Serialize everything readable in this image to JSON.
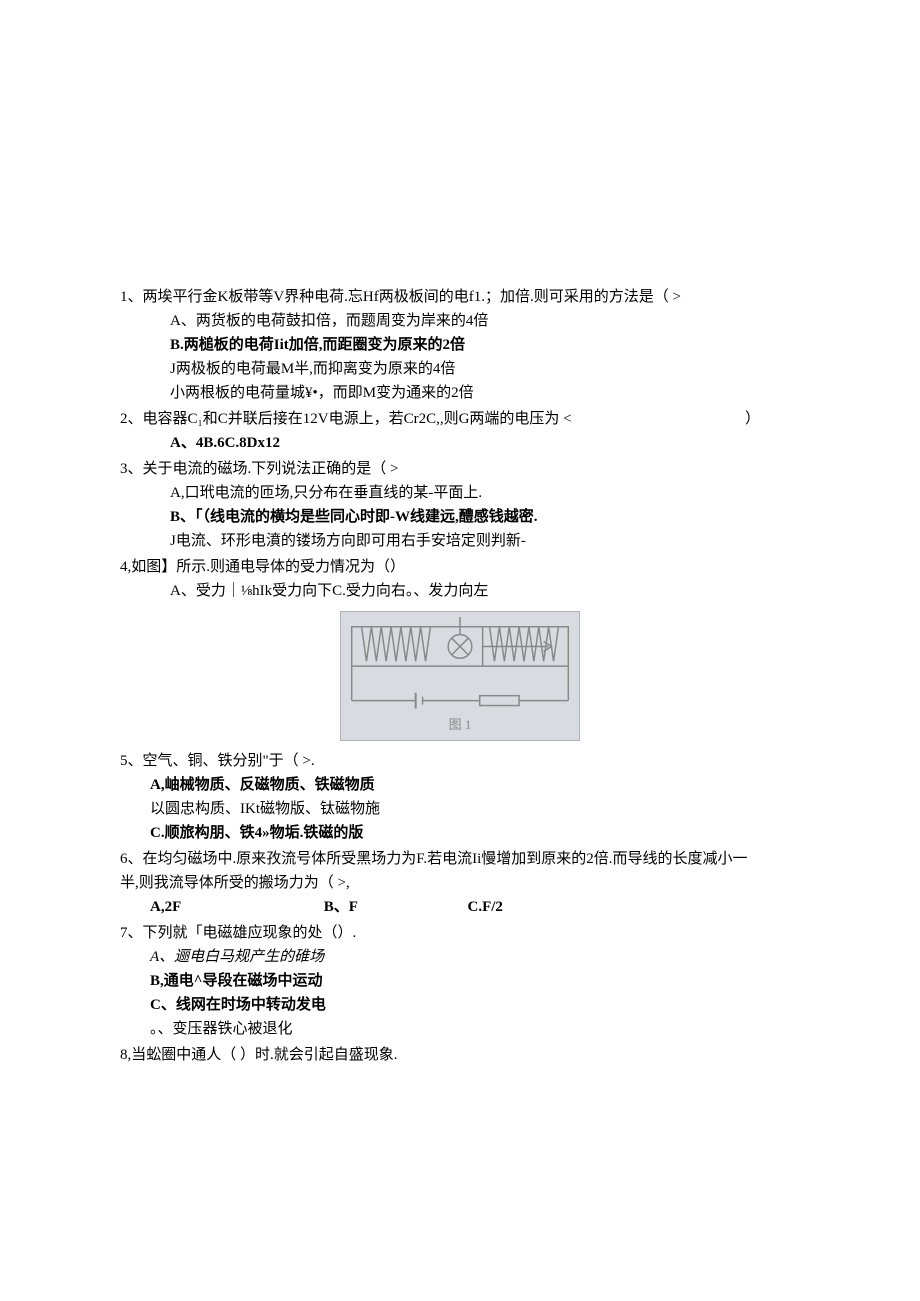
{
  "q1": {
    "stem": "1、两埃平行金K板带等V界种电荷.忘Hf两极板间的电f1.；加倍.则可采用的方法是（ >",
    "optA": "A、两货板的电荷鼓扣倍，而题周变为岸来的4倍",
    "optB": "B.两槌板的电荷Iit加倍,而距圈变为原来的2倍",
    "optC": "J两极板的电荷最M半,而抑离变为原来的4倍",
    "optD": "小两根板的电荷量城¥•，而即M变为通来的2倍"
  },
  "q2": {
    "stem_a": "2、电容器C₁和C并联后接在12V电源上，若Cr2C,,则G两端的电压为 <",
    "stem_paren": "）",
    "optA": "A、4B.6C.8Dx12"
  },
  "q3": {
    "stem": "3、关于电流的磁场.下列说法正确的是（ >",
    "optA": "A,口玳电流的匝场,只分布在垂直线的某-平面上.",
    "optB": "B、「（线电流的横均是些同心时即-W线建远,醴感钱越密.",
    "optC": "J电流、环形电濆的镂场方向即可用右手安培定则判新-"
  },
  "q4": {
    "stem": "4,如图】所示.则通电导体的受力情况为（）",
    "optA": "A、受力｜⅛hIk受力向下C.受力向右。、发力向左",
    "figure_label": "图 1"
  },
  "q5": {
    "stem": "5、空气、铜、铁分别\"于（ >.",
    "optA": "A,岫械物质、反磁物质、铁磁物质",
    "optB": "以圆忠构质、IKt磁物版、钛磁物施",
    "optC": "C.顺旅构朋、铁4»物垢.铁磁的版"
  },
  "q6": {
    "stem1": "6、在均匀磁场中.原来孜流号体所受黑场力为F.若电流Ii慢增加到原来的2倍.而导线的长度减小一",
    "stem2": "半,则我流导体所受的搬场力为（ >,",
    "optA": "A,2F",
    "optB": "B、F",
    "optC": "C.F/2"
  },
  "q7": {
    "stem": "7、下列就「电磁雄应现象的处（）.",
    "optA": "A、逦电白马规产生的碓场",
    "optB": "B,通电^导段在磁场中运动",
    "optC": "C、线网在时场中转动发电",
    "optD": "。、变压器铁心被退化"
  },
  "q8": {
    "stem": "8,当蚣圈中通人（          ）时.就会引起自盛现象."
  }
}
